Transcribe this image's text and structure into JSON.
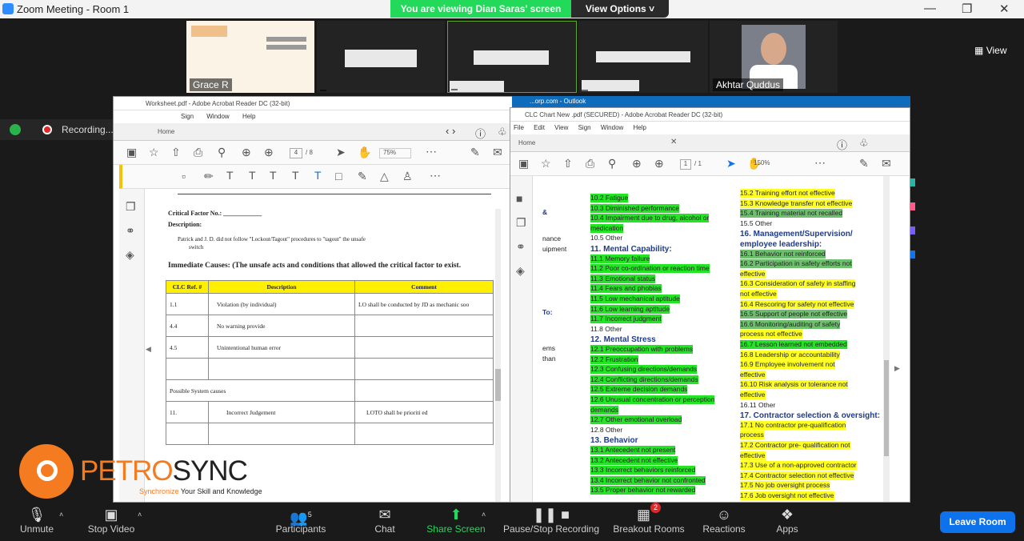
{
  "window": {
    "title": "Zoom Meeting - Room 1"
  },
  "share_banner": {
    "text": "You are viewing Dian Saras' screen",
    "view_options": "View Options"
  },
  "view_button": "View",
  "recording": {
    "label": "Recording..."
  },
  "participants": [
    {
      "name": "Grace R"
    },
    {
      "name": ""
    },
    {
      "name": ""
    },
    {
      "name": ""
    },
    {
      "name": "Akhtar Quddus"
    }
  ],
  "left_pdf": {
    "title": "Worksheet.pdf - Adobe Acrobat Reader DC (32-bit)",
    "menu": [
      "Sign",
      "Window",
      "Help"
    ],
    "tab": "Home",
    "page": "4",
    "pages": "/ 8",
    "zoom": "75%",
    "critical_factor": "Critical Factor No.: ____________",
    "description_label": "Description:",
    "description_text": "Patrick and J. D. did not follow \"Lockout/Tagout\" procedures to \"tagout\" the unsafe",
    "description_text2": "switch",
    "immediate_causes": "Immediate Causes: (The unsafe acts and conditions that allowed the critical factor to exist.",
    "table_headers": [
      "CLC Ref. #",
      "Description",
      "Comment"
    ],
    "rows": [
      [
        "1.1",
        "Violation (by individual)",
        "LO shall be conducted by JD as mechanic soo"
      ],
      [
        "4.4",
        "No warning provide",
        ""
      ],
      [
        "4.5",
        "Unintentional human error",
        ""
      ],
      [
        "",
        "",
        ""
      ],
      [
        "Possible System causes",
        "",
        ""
      ],
      [
        "11.",
        "Incorrect Judgement",
        "LOTO shall be prioriti ed"
      ],
      [
        "",
        "",
        ""
      ]
    ]
  },
  "right_pdf": {
    "title": "CLC Chart New .pdf (SECURED) - Adobe Acrobat Reader DC (32-bit)",
    "outlook_tab": "...orp.com - Outlook",
    "menu": [
      "File",
      "Edit",
      "View",
      "Sign",
      "Window",
      "Help"
    ],
    "tab": "Home",
    "page": "1",
    "pages": "/ 1",
    "zoom": "150%",
    "left_partial": [
      "&",
      "nance",
      "uipment",
      "To:",
      "ems",
      "than"
    ],
    "col1": [
      {
        "t": "10.2 Fatigue",
        "c": "g"
      },
      {
        "t": "10.3 Diminished performance",
        "c": "g"
      },
      {
        "t": "10.4 Impairment due to drug, alcohol or",
        "c": "g"
      },
      {
        "t": "       medication",
        "c": "g"
      },
      {
        "t": "10.5 Other",
        "c": ""
      },
      {
        "t": "11. Mental Capability:",
        "c": "hd"
      },
      {
        "t": "11.1 Memory failure",
        "c": "g"
      },
      {
        "t": "11.2 Poor co-ordination or reaction time",
        "c": "g"
      },
      {
        "t": "11.3 Emotional status",
        "c": "g"
      },
      {
        "t": "11.4 Fears and phobias",
        "c": "g"
      },
      {
        "t": "11.5 Low mechanical aptitude",
        "c": "g"
      },
      {
        "t": "11.6 Low learning aptitude",
        "c": "g"
      },
      {
        "t": "11.7 Incorrect judgment",
        "c": "g"
      },
      {
        "t": "11.8 Other",
        "c": ""
      },
      {
        "t": "12. Mental Stress",
        "c": "hd"
      },
      {
        "t": "12.1 Preoccupation with problems",
        "c": "g"
      },
      {
        "t": "12.2 Frustration",
        "c": "g"
      },
      {
        "t": "12.3 Confusing directions/demands",
        "c": "g"
      },
      {
        "t": "12.4   Conflicting directions/demands",
        "c": "g"
      },
      {
        "t": "12.5 Extreme decision demands",
        "c": "g"
      },
      {
        "t": "12.6 Unusual concentration or perception",
        "c": "g"
      },
      {
        "t": "        demands",
        "c": "g"
      },
      {
        "t": "12.7 Other emotional overload",
        "c": "g"
      },
      {
        "t": "12.8 Other",
        "c": ""
      },
      {
        "t": "13. Behavior",
        "c": "hd"
      },
      {
        "t": "13.1 Antecedent not present",
        "c": "g"
      },
      {
        "t": "13.2 Antecedent not effective",
        "c": "g"
      },
      {
        "t": "13.3 Incorrect behaviors reinforced",
        "c": "g"
      },
      {
        "t": "13.4 Incorrect behavior not confronted",
        "c": "g"
      },
      {
        "t": "13.5 Proper behavior not rewarded",
        "c": "g"
      }
    ],
    "col2": [
      {
        "t": "15.2 Training effort not effective",
        "c": "y"
      },
      {
        "t": "15.3 Knowledge transfer not effective",
        "c": "y"
      },
      {
        "t": "15.4 Training material not recalled",
        "c": "gr"
      },
      {
        "t": "15.5 Other",
        "c": ""
      },
      {
        "t": "16. Management/Supervision/",
        "c": "hd"
      },
      {
        "t": "     employee leadership:",
        "c": "hd"
      },
      {
        "t": "16.1   Behavior not reinforced",
        "c": "gr"
      },
      {
        "t": "16.2   Participation in safety efforts not",
        "c": "gr"
      },
      {
        "t": "         effective",
        "c": "y"
      },
      {
        "t": "16.3   Consideration of safety in staffing",
        "c": "y"
      },
      {
        "t": "         not effective",
        "c": "y"
      },
      {
        "t": "16.4   Rescoring for safety not effective",
        "c": "y"
      },
      {
        "t": "16.5   Support of people not effective",
        "c": "gr"
      },
      {
        "t": "16.6   Monitoring/auditing of safety",
        "c": "gr"
      },
      {
        "t": "         process not effective",
        "c": "y"
      },
      {
        "t": "16.7   Lesson learned not embedded",
        "c": "g"
      },
      {
        "t": "16.8   Leadership or accountability",
        "c": "y"
      },
      {
        "t": "16.9   Employee involvement not",
        "c": "y"
      },
      {
        "t": "         effective",
        "c": "y"
      },
      {
        "t": "16.10  Risk analysis or tolerance not",
        "c": "y"
      },
      {
        "t": "         effective",
        "c": "y"
      },
      {
        "t": "16.11  Other",
        "c": ""
      },
      {
        "t": "17. Contractor selection & oversight:",
        "c": "hd"
      },
      {
        "t": "17.1   No contractor pre-qualification",
        "c": "y"
      },
      {
        "t": "         process",
        "c": "y"
      },
      {
        "t": "17.2   Contractor pre- qualification not",
        "c": "y"
      },
      {
        "t": "         effective",
        "c": "y"
      },
      {
        "t": "17.3   Use of a non-approved contractor",
        "c": "y"
      },
      {
        "t": "17.4   Contractor selection not effective",
        "c": "y"
      },
      {
        "t": "17.5   No job oversight process",
        "c": "y"
      },
      {
        "t": "17.6   Job oversight not effective",
        "c": "y"
      }
    ]
  },
  "logo": {
    "p": "P",
    "e": "E",
    "t": "TRO",
    "s": "SYNC",
    "tag1": "Synchronize",
    "tag2": "Your Skill and Knowledge"
  },
  "toolbar": {
    "unmute": "Unmute",
    "stop_video": "Stop Video",
    "participants": "Participants",
    "participants_count": "5",
    "chat": "Chat",
    "share": "Share Screen",
    "record": "Pause/Stop Recording",
    "breakout": "Breakout Rooms",
    "breakout_badge": "2",
    "reactions": "Reactions",
    "apps": "Apps",
    "leave": "Leave Room"
  }
}
